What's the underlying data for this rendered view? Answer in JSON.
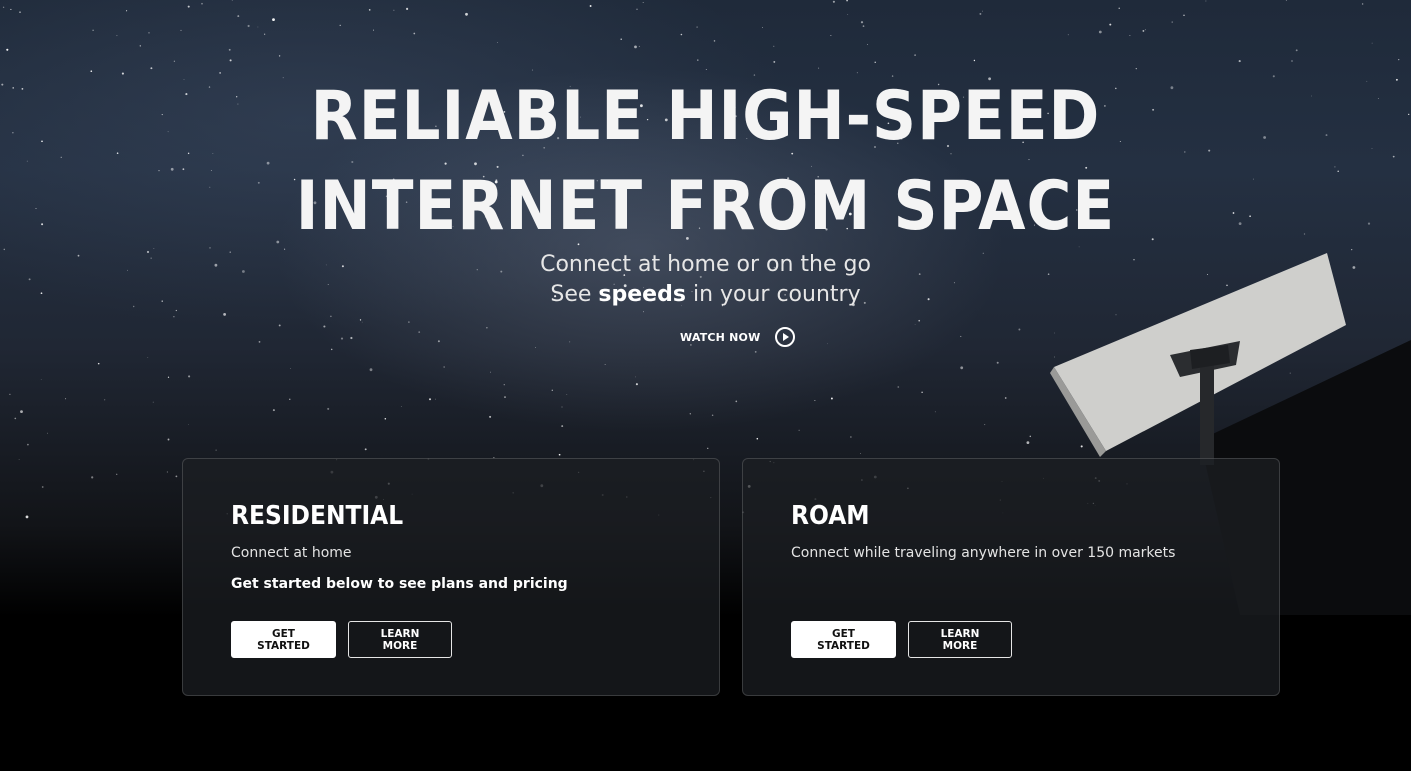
{
  "hero": {
    "headline_line1": "RELIABLE HIGH-SPEED",
    "headline_line2": "INTERNET FROM SPACE",
    "subtitle_line1": "Connect at home or on the go",
    "subtitle_line2_prefix": "See",
    "subtitle_line2_bold": "speeds",
    "subtitle_line2_suffix": "in your country",
    "watch_label": "WATCH NOW",
    "watch_icon": "play-circle-icon"
  },
  "cards": {
    "residential": {
      "title": "RESIDENTIAL",
      "description": "Connect at home",
      "note": "Get started below to see plans and pricing",
      "primary_label": "GET STARTED",
      "secondary_label": "LEARN MORE"
    },
    "roam": {
      "title": "ROAM",
      "description": "Connect while traveling anywhere in over 150 markets",
      "primary_label": "GET STARTED",
      "secondary_label": "LEARN MORE"
    }
  },
  "colors": {
    "background": "#000000",
    "sky": "#243042",
    "text": "#ffffff",
    "card_border": "#3a3c40"
  }
}
